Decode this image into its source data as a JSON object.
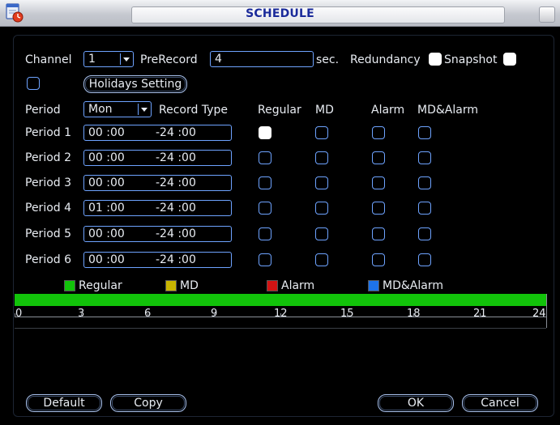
{
  "window": {
    "title": "SCHEDULE"
  },
  "top": {
    "channel_label": "Channel",
    "channel_value": "1",
    "prerecord_label": "PreRecord",
    "prerecord_value": "4",
    "sec_label": "sec.",
    "redundancy_label": "Redundancy",
    "snapshot_label": "Snapshot",
    "holidays_button": "Holidays Setting"
  },
  "header": {
    "period_label": "Period",
    "period_value": "Mon",
    "record_type_label": "Record Type",
    "col_regular": "Regular",
    "col_md": "MD",
    "col_alarm": "Alarm",
    "col_mdalarm": "MD&Alarm"
  },
  "periods": [
    {
      "label": "Period 1",
      "start": "00 :00",
      "end": "-24 :00",
      "regular": true,
      "md": false,
      "alarm": false,
      "mdalarm": false
    },
    {
      "label": "Period 2",
      "start": "00 :00",
      "end": "-24 :00",
      "regular": false,
      "md": false,
      "alarm": false,
      "mdalarm": false
    },
    {
      "label": "Period 3",
      "start": "00 :00",
      "end": "-24 :00",
      "regular": false,
      "md": false,
      "alarm": false,
      "mdalarm": false
    },
    {
      "label": "Period 4",
      "start": "01 :00",
      "end": "-24 :00",
      "regular": false,
      "md": false,
      "alarm": false,
      "mdalarm": false
    },
    {
      "label": "Period 5",
      "start": "00 :00",
      "end": "-24 :00",
      "regular": false,
      "md": false,
      "alarm": false,
      "mdalarm": false
    },
    {
      "label": "Period 6",
      "start": "00 :00",
      "end": "-24 :00",
      "regular": false,
      "md": false,
      "alarm": false,
      "mdalarm": false
    }
  ],
  "legend": [
    {
      "label": "Regular",
      "color": "#12c30a"
    },
    {
      "label": "MD",
      "color": "#c8b400"
    },
    {
      "label": "Alarm",
      "color": "#d11414"
    },
    {
      "label": "MD&Alarm",
      "color": "#1e73e8"
    }
  ],
  "timeline": {
    "ticks": [
      "0",
      "3",
      "6",
      "9",
      "12",
      "15",
      "18",
      "21",
      "24"
    ],
    "fill_color": "#12c30a"
  },
  "buttons": {
    "default": "Default",
    "copy": "Copy",
    "ok": "OK",
    "cancel": "Cancel"
  }
}
